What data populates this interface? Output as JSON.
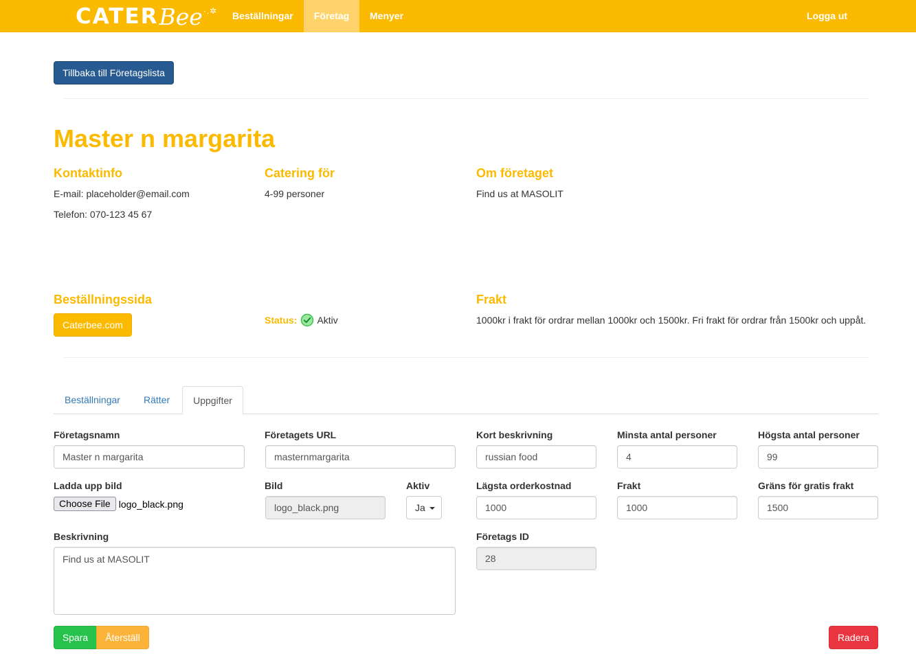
{
  "colors": {
    "brand": "#fbba00",
    "navbar_active": "#ffd36a",
    "back_button": "#275a90",
    "save": "#27c24c",
    "reset": "#fbb33a",
    "delete": "#e9353f",
    "status_check": "#3cc14a"
  },
  "navbar": {
    "logo_main": "CATER",
    "logo_script": "Bee",
    "items": [
      "Beställningar",
      "Företag",
      "Menyer"
    ],
    "active_item": "Företag",
    "logout": "Logga ut"
  },
  "back_button": "Tillbaka till Företagslista",
  "company": {
    "name": "Master n margarita",
    "contact": {
      "heading": "Kontaktinfo",
      "email": "E-mail: placeholder@email.com",
      "phone": "Telefon: 070-123 45 67"
    },
    "catering": {
      "heading": "Catering för",
      "text": "4-99 personer"
    },
    "about": {
      "heading": "Om företaget",
      "text": "Find us at MASOLIT"
    },
    "order_page": {
      "heading": "Beställningssida",
      "button": "Caterbee.com"
    },
    "status": {
      "label": "Status:",
      "icon": "check-circle-icon",
      "value": "Aktiv"
    },
    "shipping": {
      "heading": "Frakt",
      "text": "1000kr i frakt för ordrar mellan 1000kr och 1500kr. Fri frakt för ordrar från 1500kr och uppåt."
    }
  },
  "tabs": [
    "Beställningar",
    "Rätter",
    "Uppgifter"
  ],
  "active_tab": "Uppgifter",
  "form": {
    "company_name": {
      "label": "Företagsnamn",
      "value": "Master n margarita"
    },
    "company_url": {
      "label": "Företagets URL",
      "value": "masternmargarita"
    },
    "short_desc": {
      "label": "Kort beskrivning",
      "value": "russian food"
    },
    "min_persons": {
      "label": "Minsta antal personer",
      "value": "4"
    },
    "max_persons": {
      "label": "Högsta antal personer",
      "value": "99"
    },
    "upload": {
      "label": "Ladda upp bild",
      "button": "Choose File",
      "filename": "logo_black.png"
    },
    "image": {
      "label": "Bild",
      "value": "logo_black.png"
    },
    "active": {
      "label": "Aktiv",
      "value": "Ja"
    },
    "min_order_cost": {
      "label": "Lägsta orderkostnad",
      "value": "1000"
    },
    "shipping": {
      "label": "Frakt",
      "value": "1000"
    },
    "free_shipping_limit": {
      "label": "Gräns för gratis frakt",
      "value": "1500"
    },
    "description": {
      "label": "Beskrivning",
      "value": "Find us at MASOLIT"
    },
    "company_id": {
      "label": "Företags ID",
      "value": "28"
    }
  },
  "buttons": {
    "save": "Spara",
    "reset": "Återställ",
    "delete": "Radera"
  }
}
